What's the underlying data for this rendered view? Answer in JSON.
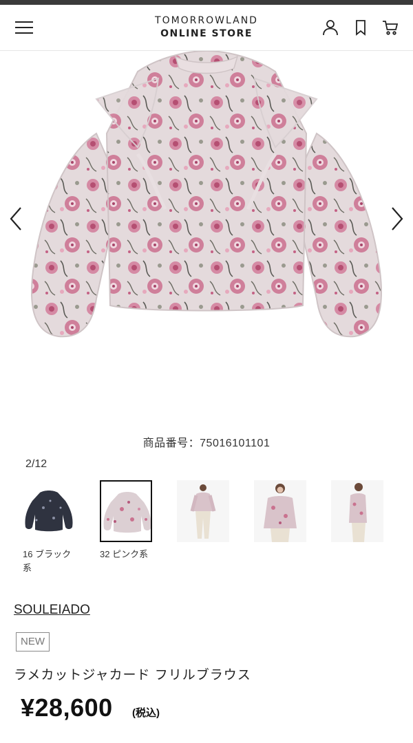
{
  "header": {
    "logo_line1": "TOMORROWLAND",
    "logo_line2": "ONLINE STORE",
    "icons": [
      "menu-icon",
      "account-icon",
      "bookmark-icon",
      "cart-icon"
    ]
  },
  "gallery": {
    "counter": "2/12",
    "product_code": "商品番号：75016101101"
  },
  "thumbnails": [
    {
      "label": "16 ブラック系"
    },
    {
      "label": "32 ピンク系"
    },
    {
      "label": ""
    },
    {
      "label": ""
    },
    {
      "label": ""
    }
  ],
  "product": {
    "brand": "SOULEIADO",
    "badge": "NEW",
    "name": "ラメカットジャカード フリルブラウス",
    "price": "¥28,600",
    "tax_note": "(税込)"
  },
  "colors": {
    "topbar": "#3a3a3a",
    "blouse_base": "#d9cfd2",
    "blouse_pink": "#c9728f",
    "dark_blouse": "#2f3340"
  }
}
